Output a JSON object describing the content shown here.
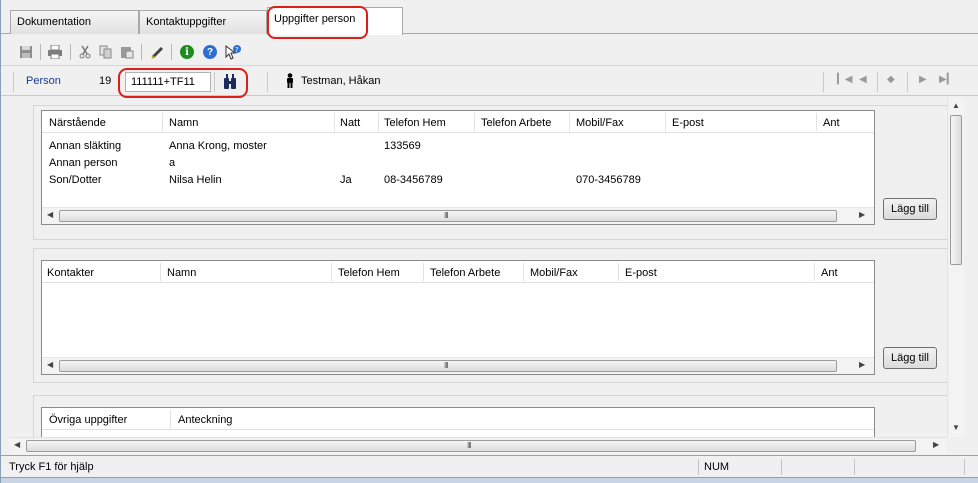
{
  "tabs": [
    {
      "label": "Dokumentation"
    },
    {
      "label": "Kontaktuppgifter"
    },
    {
      "label": "Uppgifter person"
    }
  ],
  "person_bar": {
    "label": "Person",
    "pn_prefix": "19",
    "pn_value": "111111+TF11",
    "name": "Testman, Håkan"
  },
  "relatives": {
    "columns": [
      "Närstående",
      "Namn",
      "Natt",
      "Telefon Hem",
      "Telefon Arbete",
      "Mobil/Fax",
      "E-post",
      "Ant"
    ],
    "rows": [
      [
        "Annan släkting",
        "Anna Krong, moster",
        "",
        "133569",
        "",
        "",
        "",
        ""
      ],
      [
        "Annan person",
        "a",
        "",
        "",
        "",
        "",
        "",
        ""
      ],
      [
        "Son/Dotter",
        "Nilsa Helin",
        "Ja",
        "08-3456789",
        "",
        "070-3456789",
        "",
        ""
      ]
    ],
    "add_label": "Lägg till"
  },
  "contacts": {
    "columns": [
      "Kontakter",
      "Namn",
      "Telefon Hem",
      "Telefon Arbete",
      "Mobil/Fax",
      "E-post",
      "Ant"
    ],
    "add_label": "Lägg till"
  },
  "other": {
    "columns": [
      "Övriga uppgifter",
      "Anteckning"
    ]
  },
  "status": {
    "help_text": "Tryck F1 för hjälp",
    "num": "NUM"
  },
  "scroll_grip": "III",
  "colors": {
    "highlight": "#d9201b",
    "person_label": "#1a3a8a"
  },
  "icons": [
    "save-icon",
    "print-icon",
    "cut-icon",
    "copy-icon",
    "paste-icon",
    "edit-pen-icon",
    "info-icon",
    "help-icon",
    "whats-this-icon",
    "binoculars-search-icon",
    "person-icon",
    "first-record-icon",
    "prev-record-icon",
    "current-record-icon",
    "next-record-icon",
    "last-record-icon"
  ]
}
